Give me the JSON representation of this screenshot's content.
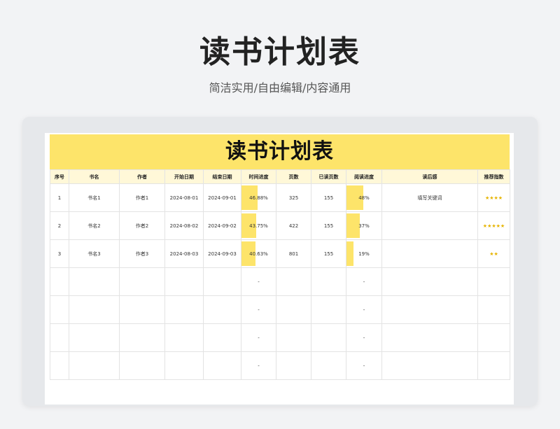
{
  "header": {
    "title": "读书计划表",
    "subtitle": "简洁实用/自由编辑/内容通用"
  },
  "sheet": {
    "title": "读书计划表",
    "columns": [
      "序号",
      "书名",
      "作者",
      "开始日期",
      "结束日期",
      "时间进度",
      "页数",
      "已读页数",
      "阅读进度",
      "读后感",
      "推荐指数"
    ],
    "rows": [
      {
        "no": "1",
        "book": "书名1",
        "author": "作者1",
        "start": "2024-08-01",
        "end": "2024-09-01",
        "time_progress": "46.88%",
        "time_pct": 0.4688,
        "pages": "325",
        "read": "155",
        "read_progress": "48%",
        "read_pct": 0.48,
        "review": "填写关键词",
        "stars": "★★★★"
      },
      {
        "no": "2",
        "book": "书名2",
        "author": "作者2",
        "start": "2024-08-02",
        "end": "2024-09-02",
        "time_progress": "43.75%",
        "time_pct": 0.4375,
        "pages": "422",
        "read": "155",
        "read_progress": "37%",
        "read_pct": 0.37,
        "review": "",
        "stars": "★★★★★"
      },
      {
        "no": "3",
        "book": "书名3",
        "author": "作者3",
        "start": "2024-08-03",
        "end": "2024-09-03",
        "time_progress": "40.63%",
        "time_pct": 0.4063,
        "pages": "801",
        "read": "155",
        "read_progress": "19%",
        "read_pct": 0.19,
        "review": "",
        "stars": "★★"
      },
      {
        "no": "",
        "book": "",
        "author": "",
        "start": "",
        "end": "",
        "time_progress": "-",
        "time_pct": 0,
        "pages": "",
        "read": "",
        "read_progress": "-",
        "read_pct": 0,
        "review": "",
        "stars": ""
      },
      {
        "no": "",
        "book": "",
        "author": "",
        "start": "",
        "end": "",
        "time_progress": "-",
        "time_pct": 0,
        "pages": "",
        "read": "",
        "read_progress": "-",
        "read_pct": 0,
        "review": "",
        "stars": ""
      },
      {
        "no": "",
        "book": "",
        "author": "",
        "start": "",
        "end": "",
        "time_progress": "-",
        "time_pct": 0,
        "pages": "",
        "read": "",
        "read_progress": "-",
        "read_pct": 0,
        "review": "",
        "stars": ""
      },
      {
        "no": "",
        "book": "",
        "author": "",
        "start": "",
        "end": "",
        "time_progress": "-",
        "time_pct": 0,
        "pages": "",
        "read": "",
        "read_progress": "-",
        "read_pct": 0,
        "review": "",
        "stars": ""
      }
    ],
    "colors": {
      "accent": "#fde46a",
      "header_bg": "#fff8d8",
      "star": "#e6b400"
    }
  }
}
